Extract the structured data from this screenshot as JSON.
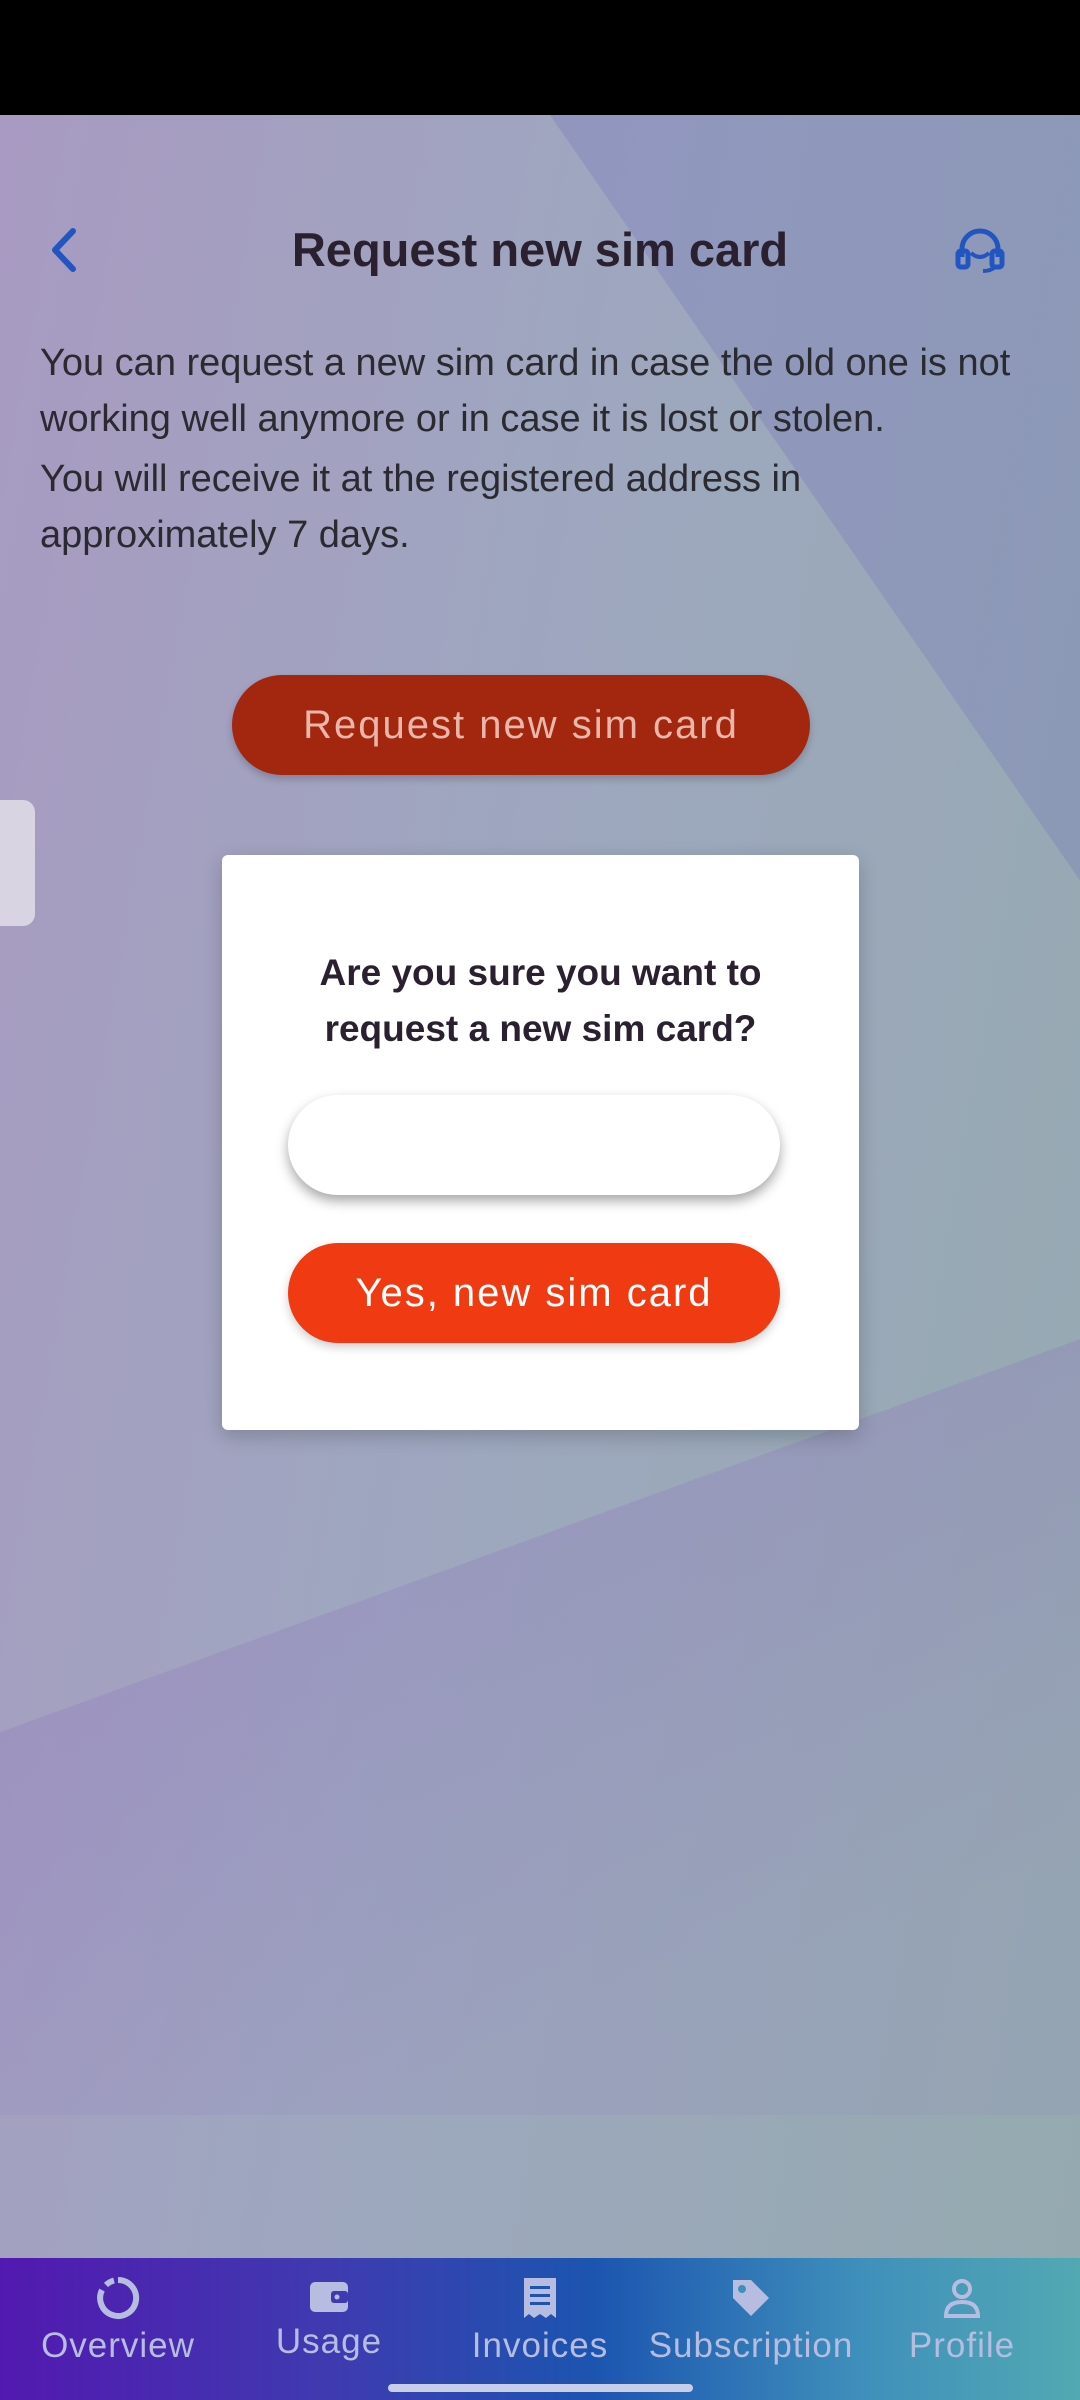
{
  "header": {
    "title": "Request new sim card",
    "back_icon": "chevron-left-icon",
    "support_icon": "headset-icon",
    "accent": "#2255c0"
  },
  "description": {
    "paragraph1": "You can request a new sim card in case the old one is not working well anymore or in case it is lost or stolen.",
    "paragraph2": "You will receive it at the registered address in approximately 7 days."
  },
  "primary_button": {
    "label": "Request new sim card",
    "color": "#a3260f"
  },
  "dialog": {
    "title": "Are you sure you want to request a new sim card?",
    "cancel_label": "",
    "confirm_label": "Yes, new sim card",
    "confirm_color": "#f03a12"
  },
  "bottom_nav": {
    "items": [
      {
        "label": "Overview",
        "icon": "donut-chart-icon"
      },
      {
        "label": "Usage",
        "icon": "wallet-icon"
      },
      {
        "label": "Invoices",
        "icon": "receipt-icon"
      },
      {
        "label": "Subscription",
        "icon": "tag-icon"
      },
      {
        "label": "Profile",
        "icon": "person-icon"
      }
    ]
  }
}
